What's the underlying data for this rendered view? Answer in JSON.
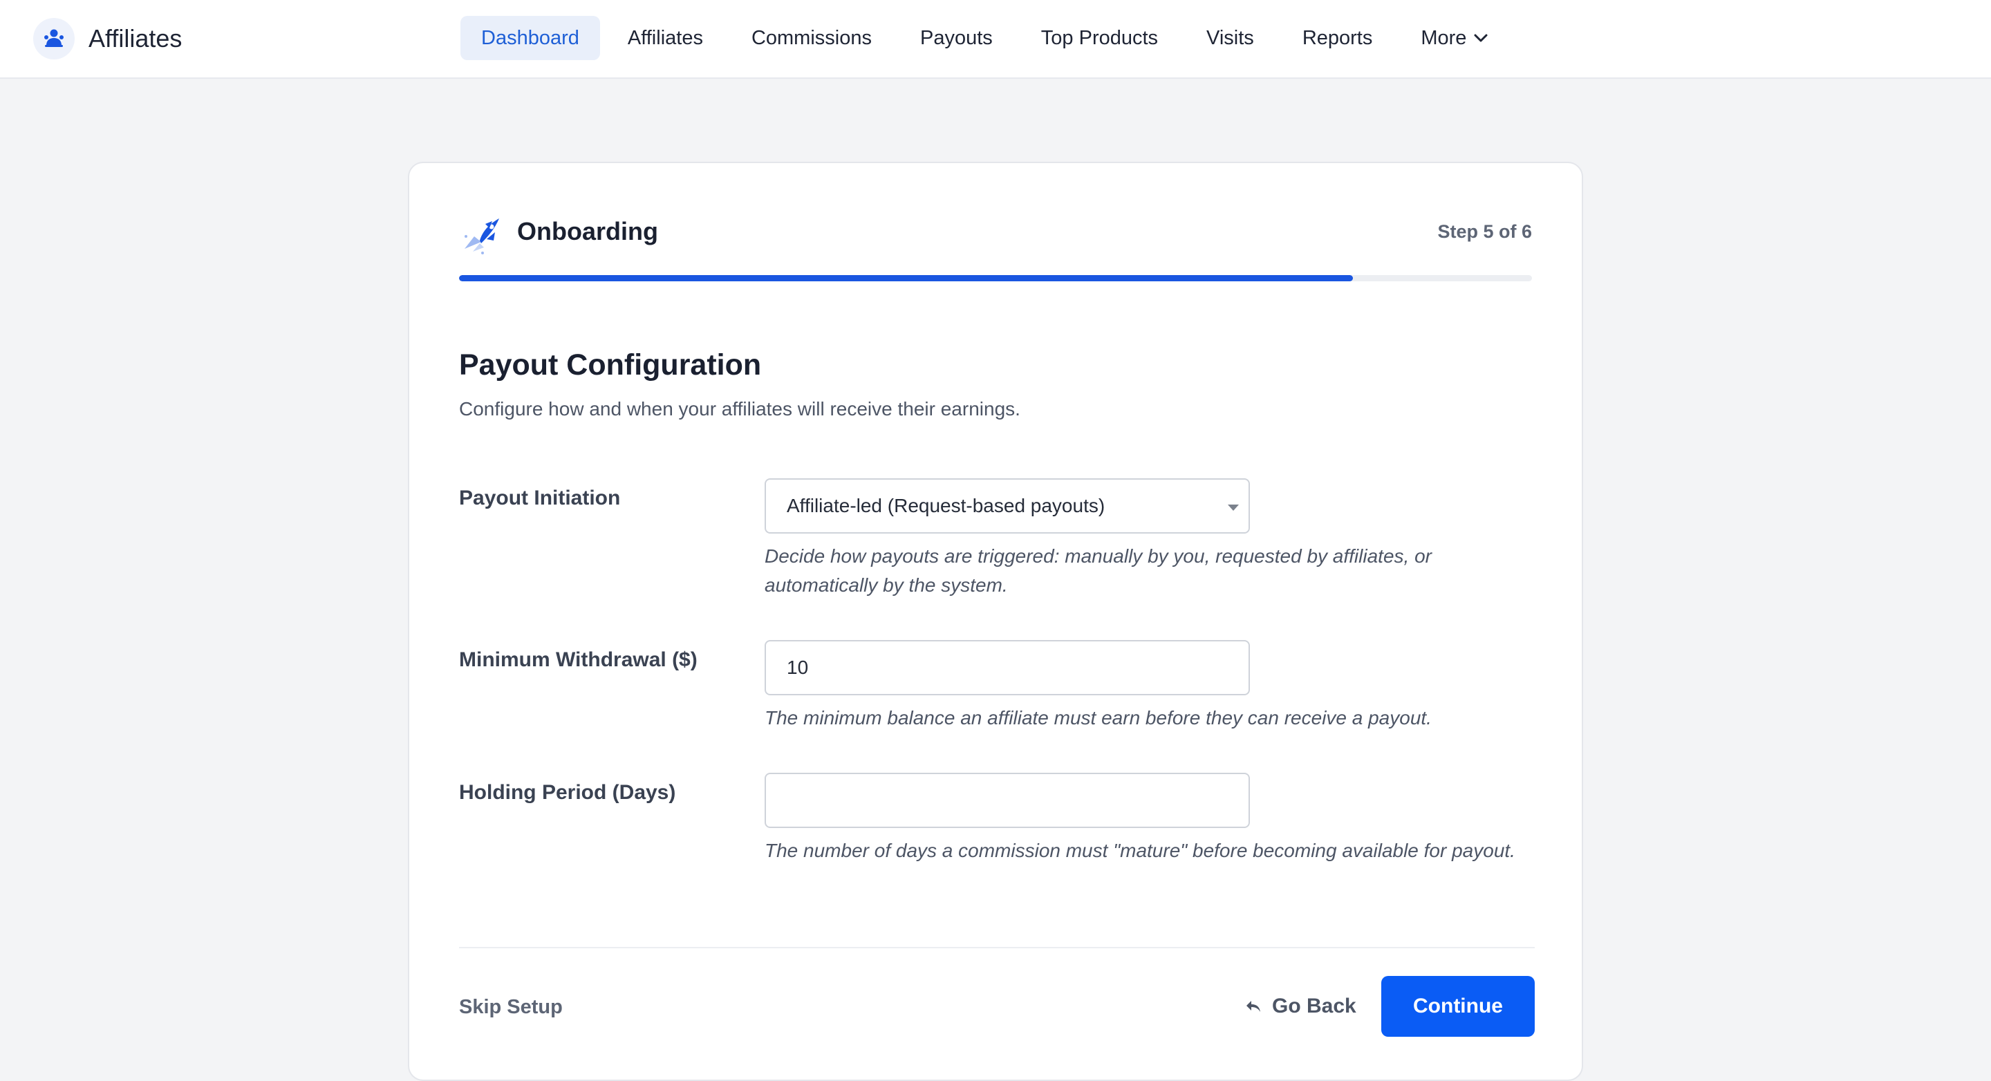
{
  "header": {
    "brand_name": "Affiliates",
    "brand_icon": "affiliates-logo-icon",
    "nav": [
      {
        "label": "Dashboard",
        "active": true
      },
      {
        "label": "Affiliates"
      },
      {
        "label": "Commissions"
      },
      {
        "label": "Payouts"
      },
      {
        "label": "Top Products"
      },
      {
        "label": "Visits"
      },
      {
        "label": "Reports"
      },
      {
        "label": "More",
        "icon": "chevron-down-icon"
      }
    ]
  },
  "onboarding": {
    "title": "Onboarding",
    "icon": "rocket-icon",
    "step_text": "Step 5 of 6",
    "progress": 0.833
  },
  "section": {
    "title": "Payout Configuration",
    "subtitle": "Configure how and when your affiliates will receive their earnings."
  },
  "fields": {
    "payout_initiation": {
      "label": "Payout Initiation",
      "value": "Affiliate-led (Request-based payouts)",
      "help": "Decide how payouts are triggered: manually by you, requested by affiliates, or automatically by the system."
    },
    "minimum_withdrawal": {
      "label": "Minimum Withdrawal ($)",
      "value": "10",
      "help": "The minimum balance an affiliate must earn before they can receive a payout."
    },
    "holding_period": {
      "label": "Holding Period (Days)",
      "value": "",
      "help": "The number of days a commission must \"mature\" before becoming available for payout."
    }
  },
  "footer": {
    "skip_label": "Skip Setup",
    "back_label": "Go Back",
    "back_icon": "reply-arrow-icon",
    "continue_label": "Continue"
  },
  "colors": {
    "accent": "#0a5cf5",
    "progress": "#1a56e0",
    "nav_active_bg": "#e9effa",
    "nav_active_text": "#1e5fd6",
    "background": "#f3f4f6"
  }
}
